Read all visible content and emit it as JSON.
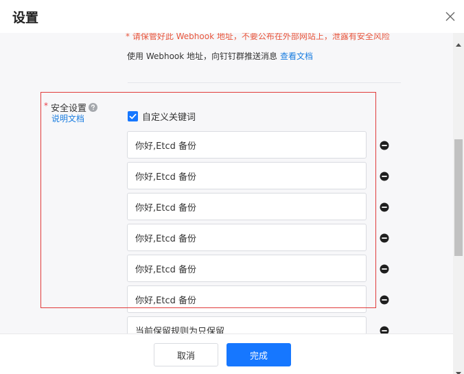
{
  "dialog": {
    "title": "设置",
    "close_icon": "close-icon"
  },
  "webhook": {
    "warning": "* 请保管好此 Webhook 地址，不要公布在外部网站上，泄露有安全风险",
    "hint": "使用 Webhook 地址，向钉钉群推送消息",
    "hint_link": "查看文档"
  },
  "security": {
    "required_mark": "*",
    "label": "安全设置",
    "help_icon": "question-circle-icon",
    "doc_link": "说明文档",
    "custom_keyword": {
      "label": "自定义关键词",
      "checked": true
    },
    "keywords": [
      "你好,Etcd 备份",
      "你好,Etcd 备份",
      "你好,Etcd 备份",
      "你好,Etcd 备份",
      "你好,Etcd 备份",
      "你好,Etcd 备份",
      "当前保留规则为只保留"
    ],
    "remove_icon": "minus-circle-icon"
  },
  "footer": {
    "cancel_label": "取消",
    "ok_label": "完成"
  },
  "colors": {
    "primary": "#1677ff",
    "warning": "#e8553c",
    "highlight_border": "#e03a3a",
    "link": "#1a7de0"
  }
}
